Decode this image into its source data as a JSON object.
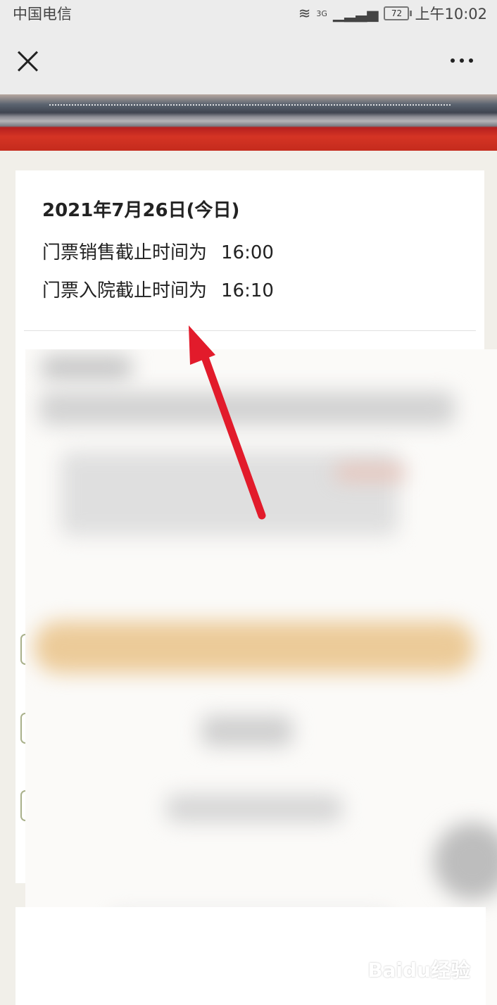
{
  "status_bar": {
    "carrier": "中国电信",
    "network": "3G",
    "battery": "72",
    "time": "上午10:02"
  },
  "navbar": {
    "close_icon": "close-icon",
    "more_icon": "more-icon"
  },
  "ticket_info": {
    "date": "2021年7月26日(今日)",
    "sales_label": "门票销售截止时间为",
    "sales_time": "16:00",
    "entry_label": "门票入院截止时间为",
    "entry_time": "16:10"
  },
  "watermark": "Baidu经验",
  "colors": {
    "banner_red": "#c9301f",
    "annotation_arrow": "#e21b2b",
    "button_blur": "#eccb99"
  }
}
